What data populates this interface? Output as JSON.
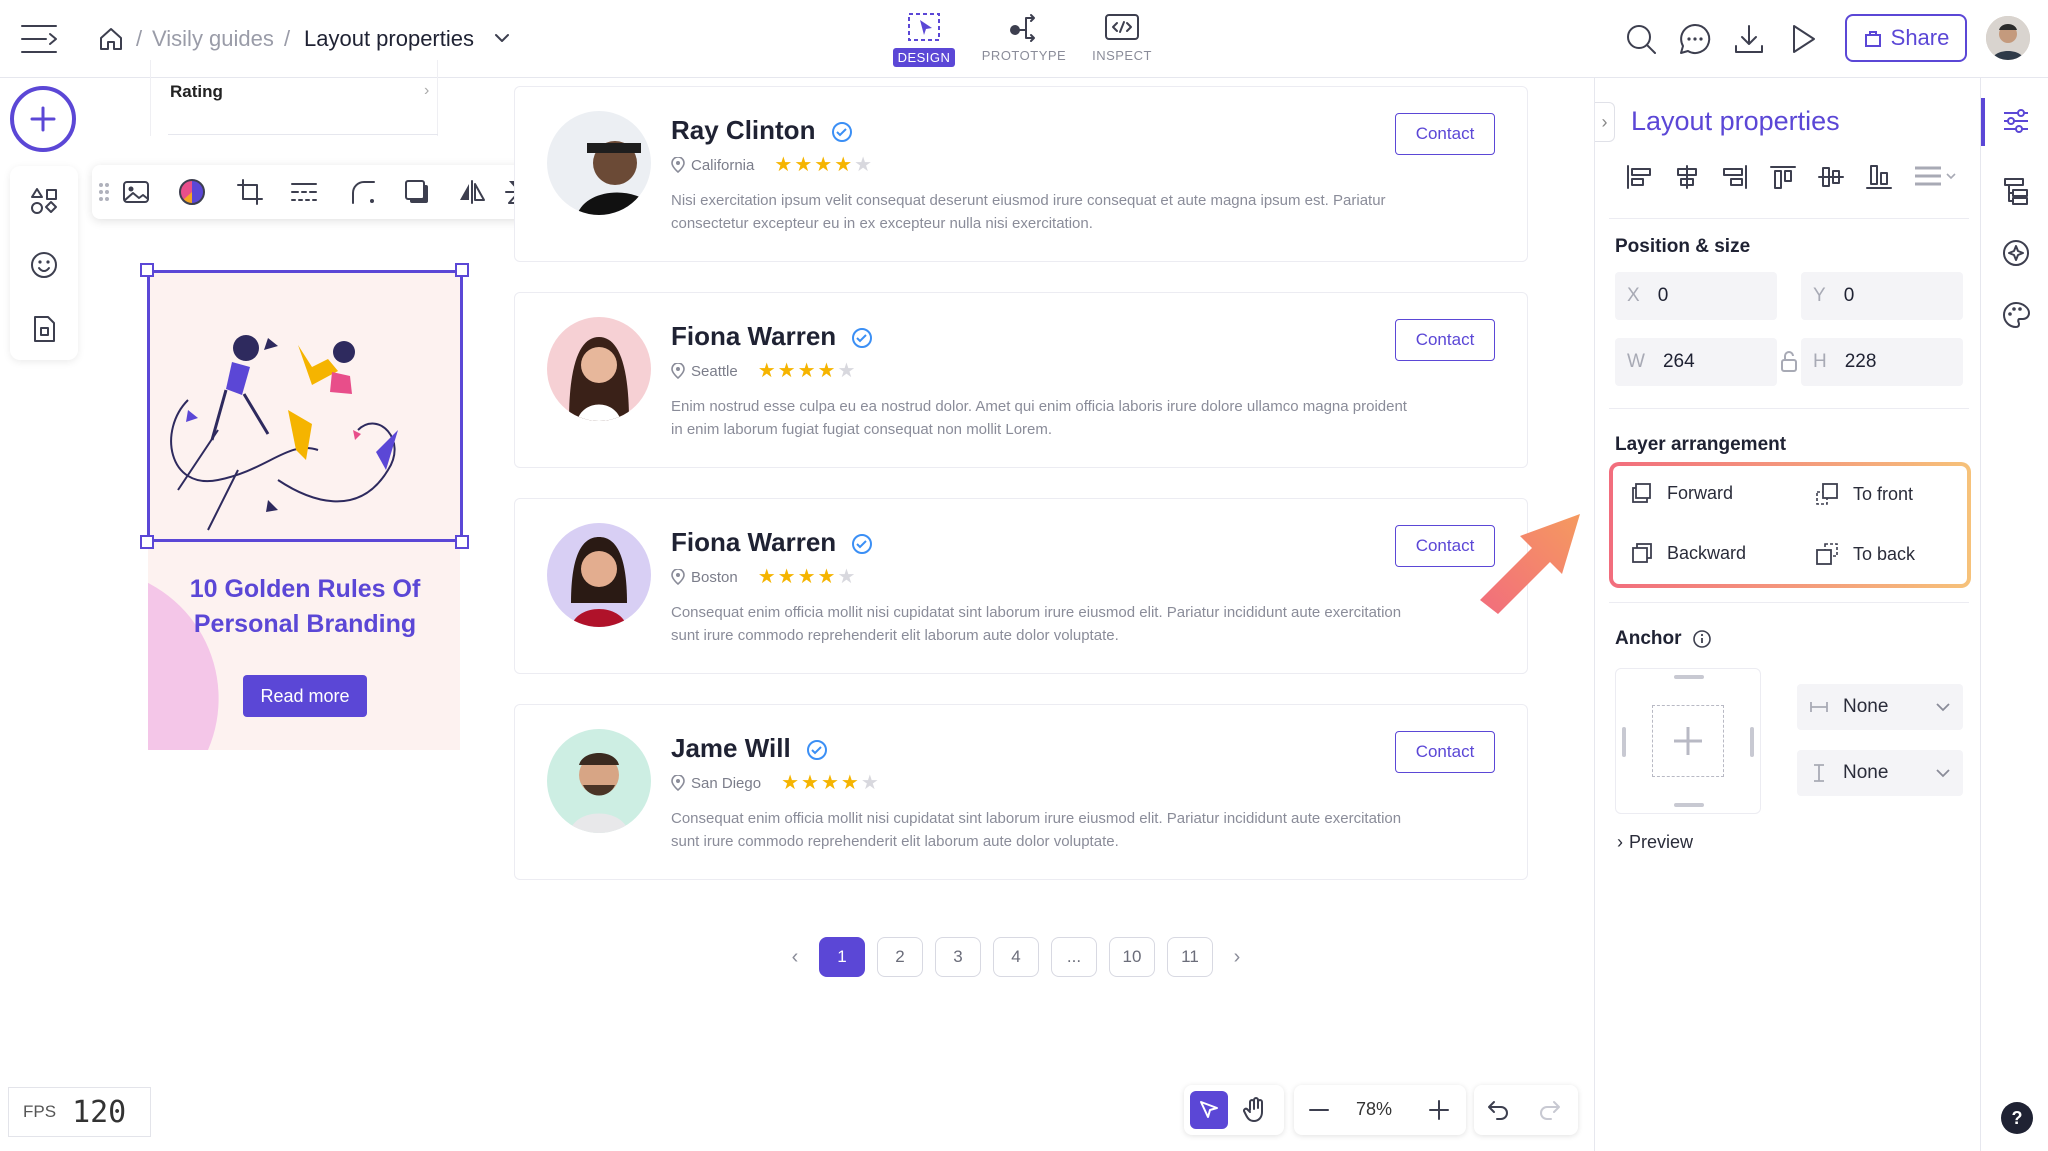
{
  "breadcrumb": {
    "project": "Visily guides",
    "page": "Layout properties"
  },
  "modes": {
    "design": "DESIGN",
    "prototype": "PROTOTYPE",
    "inspect": "INSPECT"
  },
  "header": {
    "share_label": "Share"
  },
  "canvas": {
    "rating_label": "Rating",
    "promo_card": {
      "title": "10 Golden Rules Of Personal Branding",
      "button": "Read more"
    }
  },
  "people": [
    {
      "name": "Ray Clinton",
      "location": "California",
      "rating": 4,
      "max_rating": 5,
      "contact": "Contact",
      "description": "Nisi exercitation ipsum velit consequat deserunt eiusmod irure consequat et aute magna ipsum est. Pariatur consectetur excepteur eu in ex excepteur nulla nisi exercitation."
    },
    {
      "name": "Fiona Warren",
      "location": "Seattle",
      "rating": 4,
      "max_rating": 5,
      "contact": "Contact",
      "description": "Enim nostrud esse culpa eu ea nostrud dolor. Amet qui enim officia laboris irure dolore ullamco magna proident in enim laborum fugiat fugiat consequat non mollit Lorem."
    },
    {
      "name": "Fiona Warren",
      "location": "Boston",
      "rating": 4,
      "max_rating": 5,
      "contact": "Contact",
      "description": "Consequat enim officia mollit nisi cupidatat sint laborum irure eiusmod elit. Pariatur incididunt aute exercitation sunt irure commodo reprehenderit elit laborum aute dolor voluptate."
    },
    {
      "name": "Jame Will",
      "location": "San Diego",
      "rating": 4,
      "max_rating": 5,
      "contact": "Contact",
      "description": "Consequat enim officia mollit nisi cupidatat sint laborum irure eiusmod elit. Pariatur incididunt aute exercitation sunt irure commodo reprehenderit elit laborum aute dolor voluptate."
    }
  ],
  "pagination": {
    "pages": [
      "1",
      "2",
      "3",
      "4",
      "...",
      "10",
      "11"
    ],
    "current": "1"
  },
  "fps": {
    "label": "FPS",
    "value": "120"
  },
  "zoom": {
    "level": "78%"
  },
  "panel": {
    "title": "Layout properties",
    "position_size": {
      "title": "Position & size",
      "x_label": "X",
      "x": "0",
      "y_label": "Y",
      "y": "0",
      "w_label": "W",
      "w": "264",
      "h_label": "H",
      "h": "228"
    },
    "layer_arrangement": {
      "title": "Layer arrangement",
      "forward": "Forward",
      "to_front": "To front",
      "backward": "Backward",
      "to_back": "To back"
    },
    "anchor": {
      "title": "Anchor",
      "horizontal": "None",
      "vertical": "None"
    },
    "preview": "Preview"
  },
  "colors": {
    "accent": "#5b47d6",
    "star": "#f5b400",
    "highlight_start": "#f26d7d",
    "highlight_end": "#f6c27a"
  }
}
